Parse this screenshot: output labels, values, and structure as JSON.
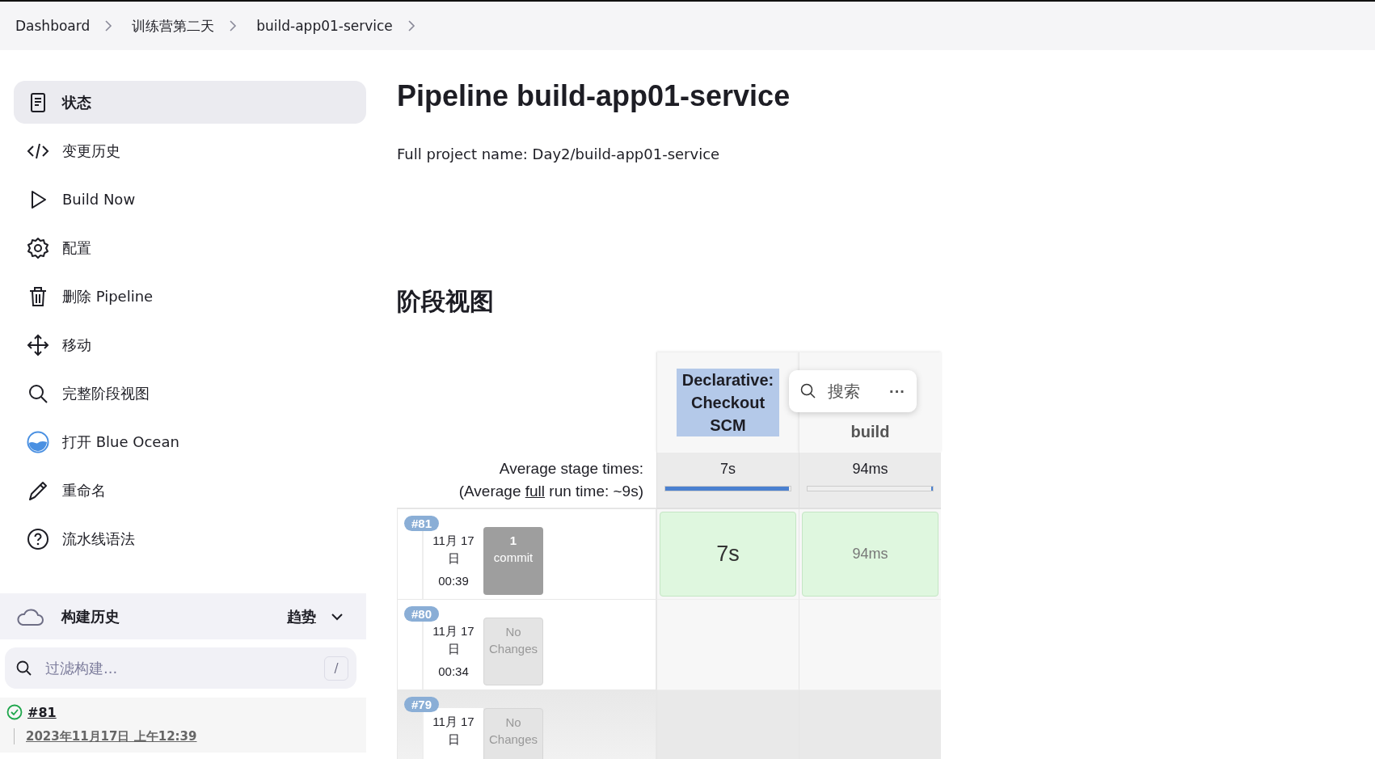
{
  "breadcrumbs": [
    "Dashboard",
    "训练营第二天",
    "build-app01-service"
  ],
  "sidebar": {
    "items": [
      {
        "kind": "status",
        "label": "状态",
        "selected": true
      },
      {
        "kind": "changes",
        "label": "变更历史",
        "selected": false
      },
      {
        "kind": "build",
        "label": "Build Now",
        "selected": false
      },
      {
        "kind": "configure",
        "label": "配置",
        "selected": false
      },
      {
        "kind": "delete",
        "label": "删除 Pipeline",
        "selected": false
      },
      {
        "kind": "move",
        "label": "移动",
        "selected": false
      },
      {
        "kind": "stages",
        "label": "完整阶段视图",
        "selected": false
      },
      {
        "kind": "blueocean",
        "label": "打开 Blue Ocean",
        "selected": false
      },
      {
        "kind": "rename",
        "label": "重命名",
        "selected": false
      },
      {
        "kind": "help",
        "label": "流水线语法",
        "selected": false
      }
    ]
  },
  "build_history": {
    "title": "构建历史",
    "trend": "趋势",
    "filter": {
      "placeholder": "过滤构建..."
    },
    "shortcut": "/",
    "builds": [
      {
        "number": "#81",
        "date": "2023年11月17日 上午12:39",
        "passed": true
      }
    ]
  },
  "main": {
    "title": "Pipeline build-app01-service",
    "full_name": "Full project name: Day2/build-app01-service"
  },
  "stage_view": {
    "title": "阶段视图",
    "avg_label": "Average stage times:",
    "avg_run_prefix": "(Average ",
    "avg_run_link": "full",
    "avg_run_suffix": " run time: ~9s)",
    "stages": [
      {
        "name": "Declarative: Checkout SCM",
        "avg": "7s",
        "level": 0.99,
        "highlighted": true
      },
      {
        "name": "build",
        "avg": "94ms",
        "level": 0.01,
        "highlighted": false
      }
    ],
    "runs": [
      {
        "badge": "#81",
        "date": "11月 17 日",
        "time": "00:39",
        "kind": "commits",
        "changes_count": "1",
        "changes_label": "commit",
        "hovered": false,
        "cells": [
          {
            "duration": "7s",
            "passed": true,
            "prominent": true
          },
          {
            "duration": "94ms",
            "passed": true,
            "prominent": false
          }
        ]
      },
      {
        "badge": "#80",
        "date": "11月 17 日",
        "time": "00:34",
        "kind": "none",
        "changes_label": "No Changes",
        "hovered": false
      },
      {
        "badge": "#79",
        "date": "11月 17 日",
        "kind": "none",
        "changes_label": "No Changes",
        "hovered": true
      }
    ]
  },
  "search_popup": {
    "placeholder": "搜索",
    "more": "···"
  }
}
